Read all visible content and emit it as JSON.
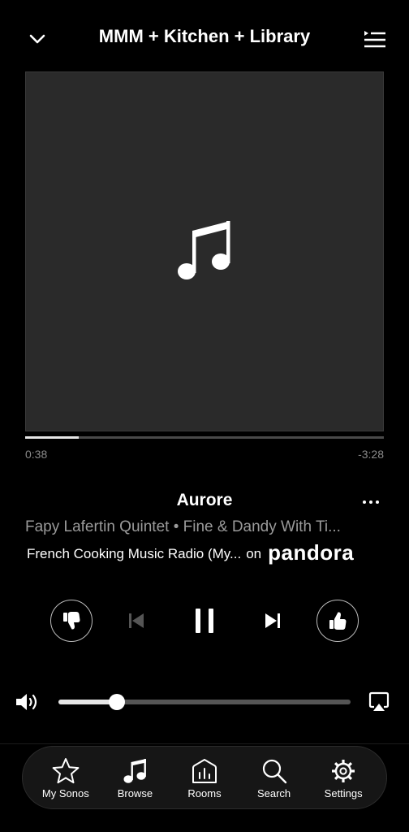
{
  "header": {
    "title": "MMM + Kitchen + Library",
    "collapse_icon": "chevron-down-icon",
    "queue_icon": "queue-list-icon"
  },
  "artwork": {
    "placeholder_icon": "music-note-icon"
  },
  "progress": {
    "elapsed": "0:38",
    "remaining": "-3:28",
    "fraction": 0.15
  },
  "track": {
    "title": "Aurore",
    "subtitle": "Fapy Lafertin Quintet • Fine & Dandy With Ti...",
    "station": "French Cooking Music Radio (My...",
    "on_label": "on",
    "service": "pandora"
  },
  "controls": {
    "thumbs_down_icon": "thumbs-down-icon",
    "previous_icon": "skip-previous-icon",
    "play_pause_icon": "pause-icon",
    "next_icon": "skip-next-icon",
    "thumbs_up_icon": "thumbs-up-icon",
    "previous_enabled": false
  },
  "volume": {
    "level": 0.2,
    "icon": "speaker-volume-icon",
    "airplay_icon": "airplay-icon"
  },
  "tabs": [
    {
      "label": "My Sonos",
      "icon": "star-icon"
    },
    {
      "label": "Browse",
      "icon": "music-note-icon"
    },
    {
      "label": "Rooms",
      "icon": "rooms-house-icon"
    },
    {
      "label": "Search",
      "icon": "search-icon"
    },
    {
      "label": "Settings",
      "icon": "gear-icon"
    }
  ],
  "colors": {
    "background": "#000000",
    "artwork_bg": "#2a2a2a",
    "progress_fill": "#e6e6e6",
    "muted_text": "#9a9a9a",
    "tabbar_bg": "#161616"
  }
}
